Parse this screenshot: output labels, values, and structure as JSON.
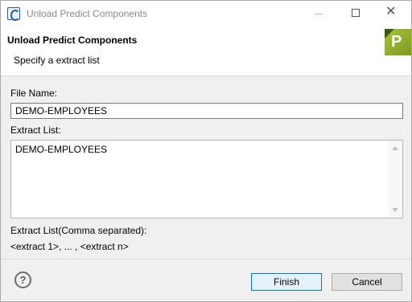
{
  "window": {
    "title": "Unload Predict Components"
  },
  "header": {
    "title": "Unload Predict Components",
    "subtitle": "Specify a extract list",
    "banner_letter": "P"
  },
  "form": {
    "file_name_label": "File Name:",
    "file_name_value": "DEMO-EMPLOYEES",
    "extract_list_label": "Extract List:",
    "extract_list_value": "DEMO-EMPLOYEES",
    "comma_label": "Extract List(Comma separated):",
    "hint": "<extract 1>, ... , <extract n>"
  },
  "footer": {
    "help_glyph": "?",
    "finish_label": "Finish",
    "cancel_label": "Cancel"
  },
  "icons": {
    "app": "app-window-icon",
    "banner": "predict-banner-icon",
    "help": "help-icon"
  },
  "colors": {
    "banner_green": "#8fb12a",
    "focus_blue": "#0078d7"
  }
}
